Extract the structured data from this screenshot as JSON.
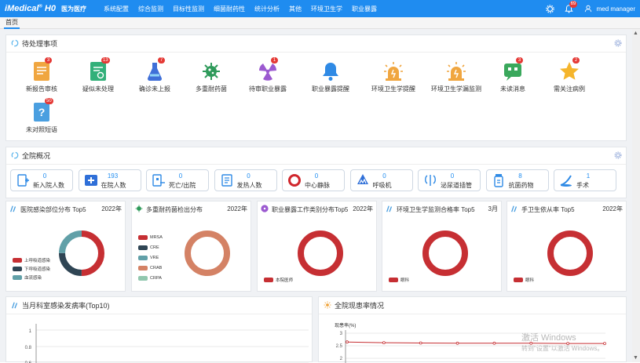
{
  "app": {
    "logo": "iMedical",
    "logo_sup": "®",
    "logo_suffix": "H0",
    "subtitle": "医为医疗"
  },
  "nav": [
    "系统配置",
    "综合监测",
    "目标性监测",
    "细菌耐药性",
    "统计分析",
    "其他",
    "环境卫生学",
    "职业暴露"
  ],
  "topright": {
    "notif_count": "69",
    "user": "med manager"
  },
  "tabs": [
    "首页"
  ],
  "pending": {
    "title": "待处理事项",
    "items": [
      {
        "label": "新报告审核",
        "badge": "3",
        "icon": "new-report-icon"
      },
      {
        "label": "疑似未处理",
        "badge": "13",
        "icon": "suspect-icon"
      },
      {
        "label": "确诊未上报",
        "badge": "7",
        "icon": "flask-icon"
      },
      {
        "label": "多重耐药菌",
        "badge": "",
        "icon": "bacteria-icon"
      },
      {
        "label": "待审职业暴露",
        "badge": "1",
        "icon": "radiation-icon"
      },
      {
        "label": "职业暴露提醒",
        "badge": "",
        "icon": "bell-icon"
      },
      {
        "label": "环境卫生学提醒",
        "badge": "",
        "icon": "warning-light-icon"
      },
      {
        "label": "环境卫生学漏监测",
        "badge": "",
        "icon": "warning-light-icon"
      },
      {
        "label": "未读消息",
        "badge": "3",
        "icon": "message-icon"
      },
      {
        "label": "需关注病例",
        "badge": "2",
        "icon": "star-icon"
      },
      {
        "label": "未对照短语",
        "badge": "50",
        "icon": "question-icon"
      }
    ]
  },
  "overview": {
    "title": "全院概况",
    "items": [
      {
        "label": "新入院人数",
        "value": "0",
        "icon": "new-admission-icon"
      },
      {
        "label": "在院人数",
        "value": "193",
        "icon": "inpatient-icon"
      },
      {
        "label": "死亡/出院",
        "value": "0",
        "icon": "discharge-icon"
      },
      {
        "label": "发热人数",
        "value": "0",
        "icon": "fever-icon"
      },
      {
        "label": "中心静脉",
        "value": "0",
        "icon": "central-line-icon"
      },
      {
        "label": "呼吸机",
        "value": "0",
        "icon": "ventilator-icon"
      },
      {
        "label": "泌尿道插管",
        "value": "0",
        "icon": "urinary-catheter-icon"
      },
      {
        "label": "抗菌药物",
        "value": "8",
        "icon": "antibiotic-icon"
      },
      {
        "label": "手术",
        "value": "1",
        "icon": "surgery-icon"
      }
    ]
  },
  "chart_data": [
    {
      "type": "pie",
      "title": "医院感染部位分布 Top5",
      "period": "2022年",
      "categories": [
        "上呼吸道感染",
        "下呼吸道感染",
        "血流感染"
      ],
      "values": [
        50,
        25,
        25
      ],
      "colors": [
        "#c62f33",
        "#2f4554",
        "#61a0a8"
      ]
    },
    {
      "type": "pie",
      "title": "多重耐药菌检出分布",
      "period": "2022年",
      "categories": [
        "MRSA",
        "CRE",
        "VRE",
        "CRAB",
        "CRPA"
      ],
      "values": [
        0,
        0,
        0,
        1,
        0
      ],
      "colors": [
        "#c62f33",
        "#2f4554",
        "#61a0a8",
        "#d48265",
        "#91c7ae"
      ]
    },
    {
      "type": "pie",
      "title": "职业暴露工作类别分布Top5",
      "period": "2022年",
      "categories": [
        "本院医师"
      ],
      "values": [
        1
      ],
      "colors": [
        "#c62f33"
      ]
    },
    {
      "type": "pie",
      "title": "环境卫生学监测合格率 Top5",
      "period": "3月",
      "categories": [
        "眼科"
      ],
      "values": [
        1
      ],
      "colors": [
        "#c62f33"
      ]
    },
    {
      "type": "pie",
      "title": "手卫生依从率 Top5",
      "period": "2022年",
      "categories": [
        "眼科"
      ],
      "values": [
        1
      ],
      "colors": [
        "#c62f33"
      ]
    },
    {
      "type": "bar",
      "title": "当月科室感染发病率(Top10)",
      "categories": [],
      "values": [],
      "yticks": [
        "1",
        "0.8",
        "0.6"
      ],
      "ylim": [
        0,
        1
      ]
    },
    {
      "type": "line",
      "title": "全院现患率情况",
      "ylabel": "现患率(%)",
      "yticks": [
        "3",
        "2.5",
        "2"
      ],
      "ylim": [
        2,
        3
      ],
      "values": [
        2.65,
        2.62,
        2.61,
        2.6,
        2.6,
        2.6,
        2.59,
        2.59
      ]
    }
  ],
  "watermark": {
    "line1": "激活 Windows",
    "line2": "转到\"设置\"以激活 Windows。"
  }
}
